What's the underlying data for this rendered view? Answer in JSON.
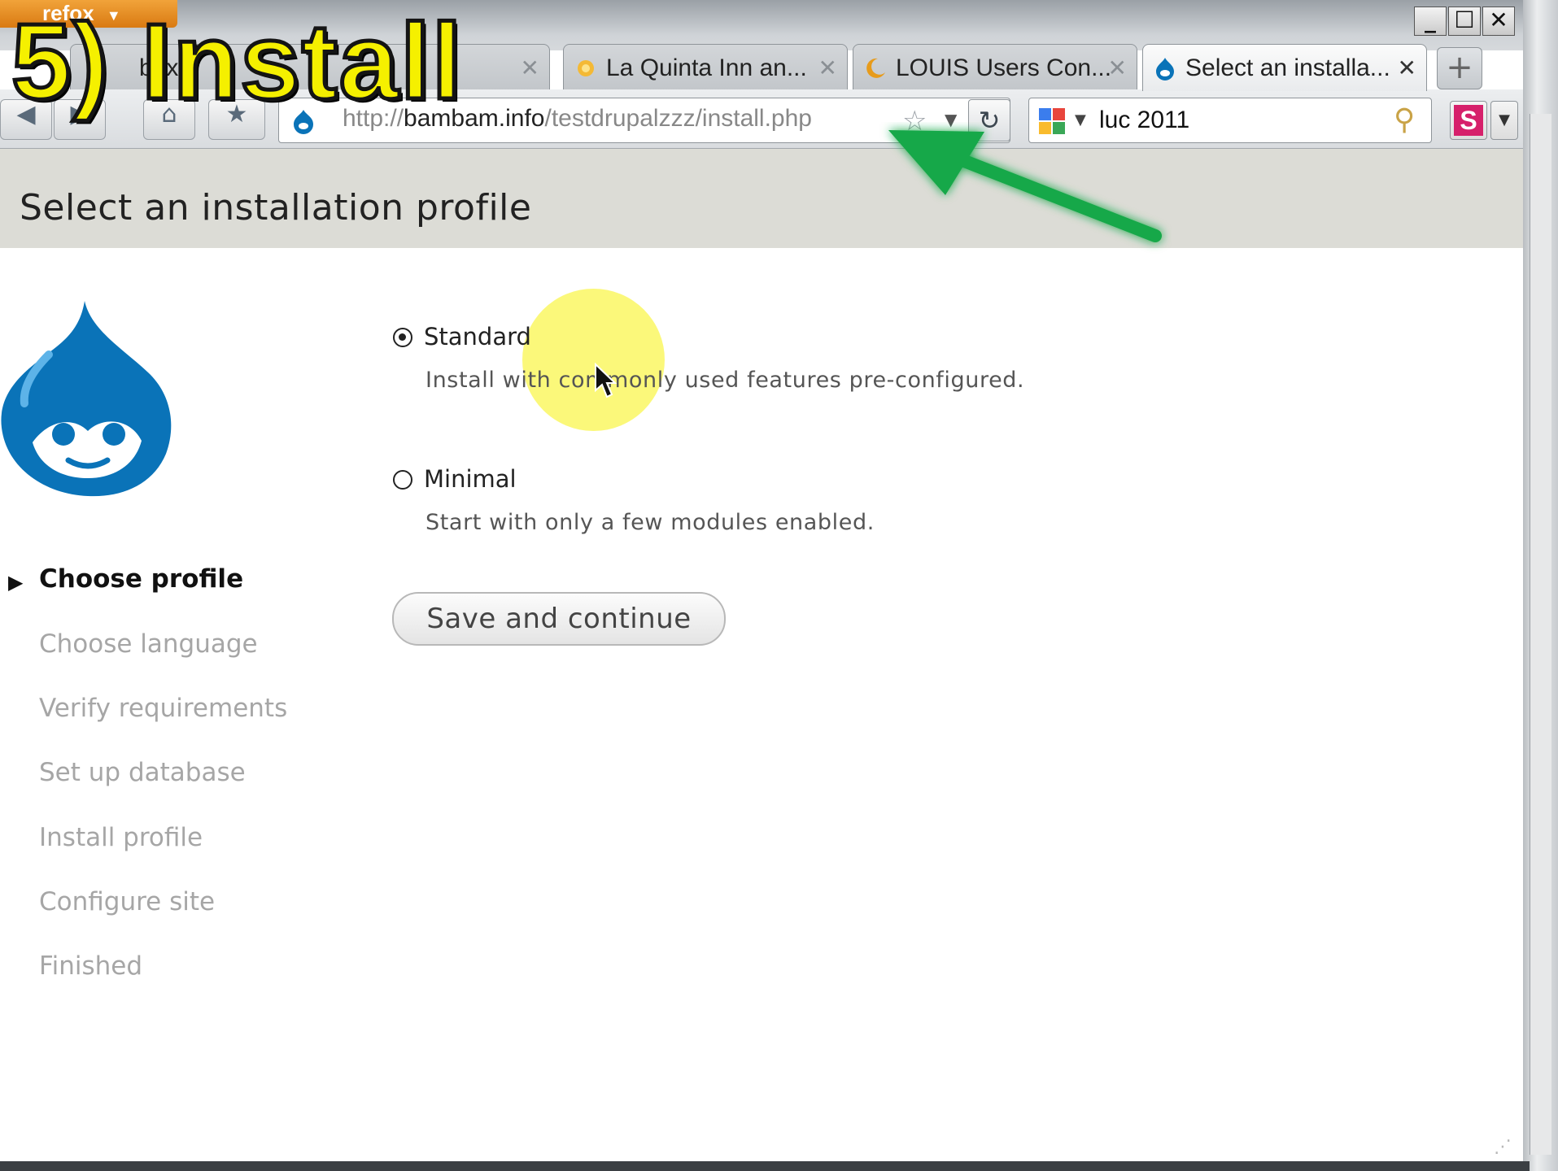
{
  "browser": {
    "app_button": "refox",
    "window_controls": {
      "minimize": "_",
      "maximize": "☐",
      "close": "✕"
    },
    "tabs": [
      {
        "label": "box",
        "active": false
      },
      {
        "label": "La Quinta Inn an...",
        "active": false
      },
      {
        "label": "LOUIS Users Con...",
        "active": false
      },
      {
        "label": "Select an installa...",
        "active": true
      }
    ],
    "new_tab": "+",
    "url": {
      "scheme": "http://",
      "host": "bambam.info",
      "path": "/testdrupalzzz/install.php"
    },
    "search": {
      "value": "luc 2011"
    },
    "s_button": "S"
  },
  "page": {
    "title": "Select an installation profile",
    "tasks": [
      {
        "label": "Choose profile",
        "active": true
      },
      {
        "label": "Choose language",
        "active": false
      },
      {
        "label": "Verify requirements",
        "active": false
      },
      {
        "label": "Set up database",
        "active": false
      },
      {
        "label": "Install profile",
        "active": false
      },
      {
        "label": "Configure site",
        "active": false
      },
      {
        "label": "Finished",
        "active": false
      }
    ],
    "profiles": [
      {
        "label": "Standard",
        "description": "Install with commonly used features pre-configured.",
        "selected": true
      },
      {
        "label": "Minimal",
        "description": "Start with only a few modules enabled.",
        "selected": false
      }
    ],
    "submit_label": "Save and continue"
  },
  "overlay": {
    "caption": "5) Install",
    "caption_color": "#f5f000",
    "arrow_color": "#17a84a",
    "highlight_color": "#faf546"
  },
  "colors": {
    "header_band": "#dcdcd6",
    "drupal_blue": "#0a73b8",
    "task_inactive": "#a6a6a6"
  }
}
